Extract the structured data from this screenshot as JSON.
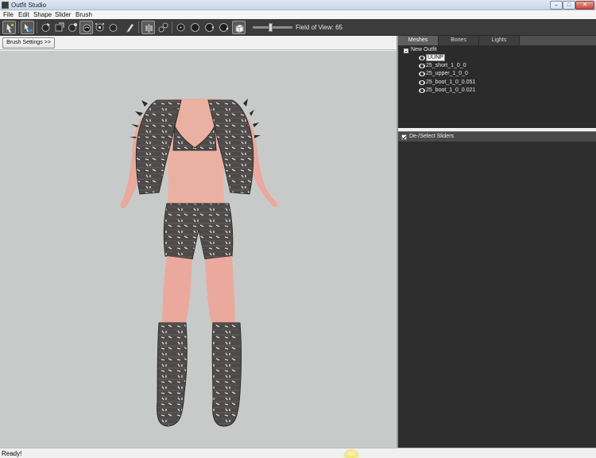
{
  "window": {
    "title": "Outfit Studio"
  },
  "menu": [
    "File",
    "Edit",
    "Shape",
    "Slider",
    "Brush"
  ],
  "toolbar": {
    "fov_label": "Field of View: 65",
    "fov_value": 65
  },
  "viewport": {
    "brush_settings_label": "Brush Settings >>"
  },
  "right_panel": {
    "tabs": [
      "Meshes",
      "Bones",
      "Lights"
    ],
    "active_tab": "Meshes",
    "tree": {
      "root": "New Outfit",
      "meshes": [
        "UUNP",
        "25_short_1_0_0",
        "25_upper_1_0_0",
        "25_boot_1_0_0.051",
        "25_boot_1_0_0.021"
      ],
      "selected": "UUNP"
    },
    "sliders_label": "De-/Select Sliders"
  },
  "status": {
    "text": "Ready!"
  },
  "colors": {
    "toolbar": "#3c3c3c",
    "viewport": "#c8cac9",
    "panel": "#2b2b2b",
    "outfit": "#4f4b4b",
    "skin": "#e9a99c"
  }
}
